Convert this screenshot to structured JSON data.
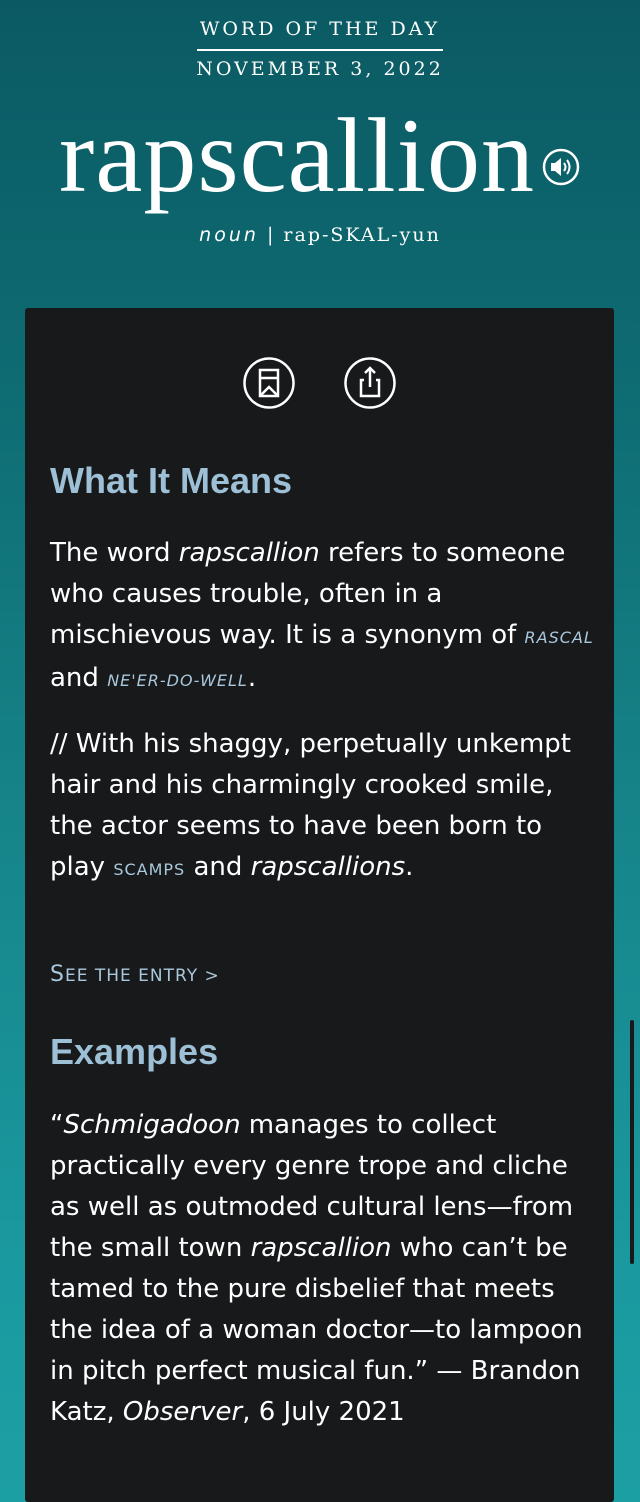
{
  "header": {
    "label": "WORD OF THE DAY",
    "date": "NOVEMBER 3, 2022",
    "word": "rapscallion",
    "part_of_speech": "noun",
    "separator": " | ",
    "pronunciation": "rap-SKAL-yun"
  },
  "actions": {
    "save_icon": "bookmark-icon",
    "share_icon": "share-icon",
    "audio_icon": "speaker-icon"
  },
  "meaning": {
    "title": "What It Means",
    "def_prefix": "The word ",
    "def_italic": "rapscallion",
    "def_mid": " refers to someone who causes trouble, often in a mischievous way. It is a synonym of ",
    "syn1": "rascal",
    "def_and": " and ",
    "syn2": "ne'er-do-well",
    "def_end": ".",
    "ex_prefix": "// With his shaggy, perpetually unkempt hair and his charmingly crooked smile, the actor seems to have been born to play ",
    "ex_link": "scamps",
    "ex_mid": " and ",
    "ex_italic": "rapscallions",
    "ex_end": ".",
    "see_entry_s": "S",
    "see_entry_rest": "EE THE ENTRY",
    "see_entry_arrow": " >"
  },
  "examples": {
    "title": "Examples",
    "q_open": "“",
    "q_italic1": "Schmigadoon",
    "q_text1": " manages to collect practically every genre trope and cliche as well as outmoded cultural lens—from the small town ",
    "q_italic2": "rapscallion",
    "q_text2": " who can’t be tamed to the pure disbelief that meets the idea of a woman doctor—to lampoon in pitch perfect musical fun.” — Brandon Katz, ",
    "q_italic3": "Observer",
    "q_text3": ", 6 July 2021"
  },
  "colors": {
    "card_bg": "#18191b",
    "heading": "#9dc0d6",
    "link": "#a9c8dc",
    "bg_top": "#0b5a63",
    "bg_bottom": "#1c9fa3"
  }
}
